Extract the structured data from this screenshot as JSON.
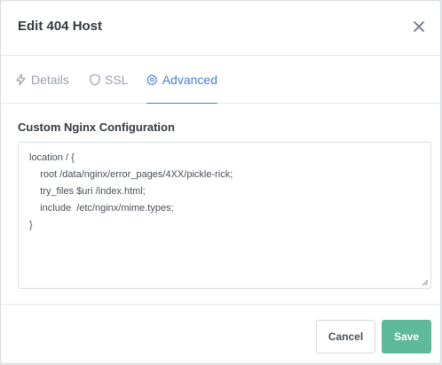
{
  "modal": {
    "title": "Edit 404 Host",
    "close_icon": "close-icon"
  },
  "tabs": [
    {
      "label": "Details",
      "icon": "bolt-icon",
      "active": false
    },
    {
      "label": "SSL",
      "icon": "shield-icon",
      "active": false
    },
    {
      "label": "Advanced",
      "icon": "gear-icon",
      "active": true
    }
  ],
  "advanced": {
    "section_label": "Custom Nginx Configuration",
    "config_lines": [
      "location / {",
      "    root /data/nginx/error_pages/4XX/pickle-rick;",
      "    try_files $uri /index.html;",
      "    include  /etc/nginx/mime.types;",
      "}"
    ]
  },
  "footer": {
    "cancel_label": "Cancel",
    "save_label": "Save"
  },
  "colors": {
    "accent": "#467fcf",
    "save_button": "#5eba9a",
    "muted_tab": "#9aa0ac"
  }
}
